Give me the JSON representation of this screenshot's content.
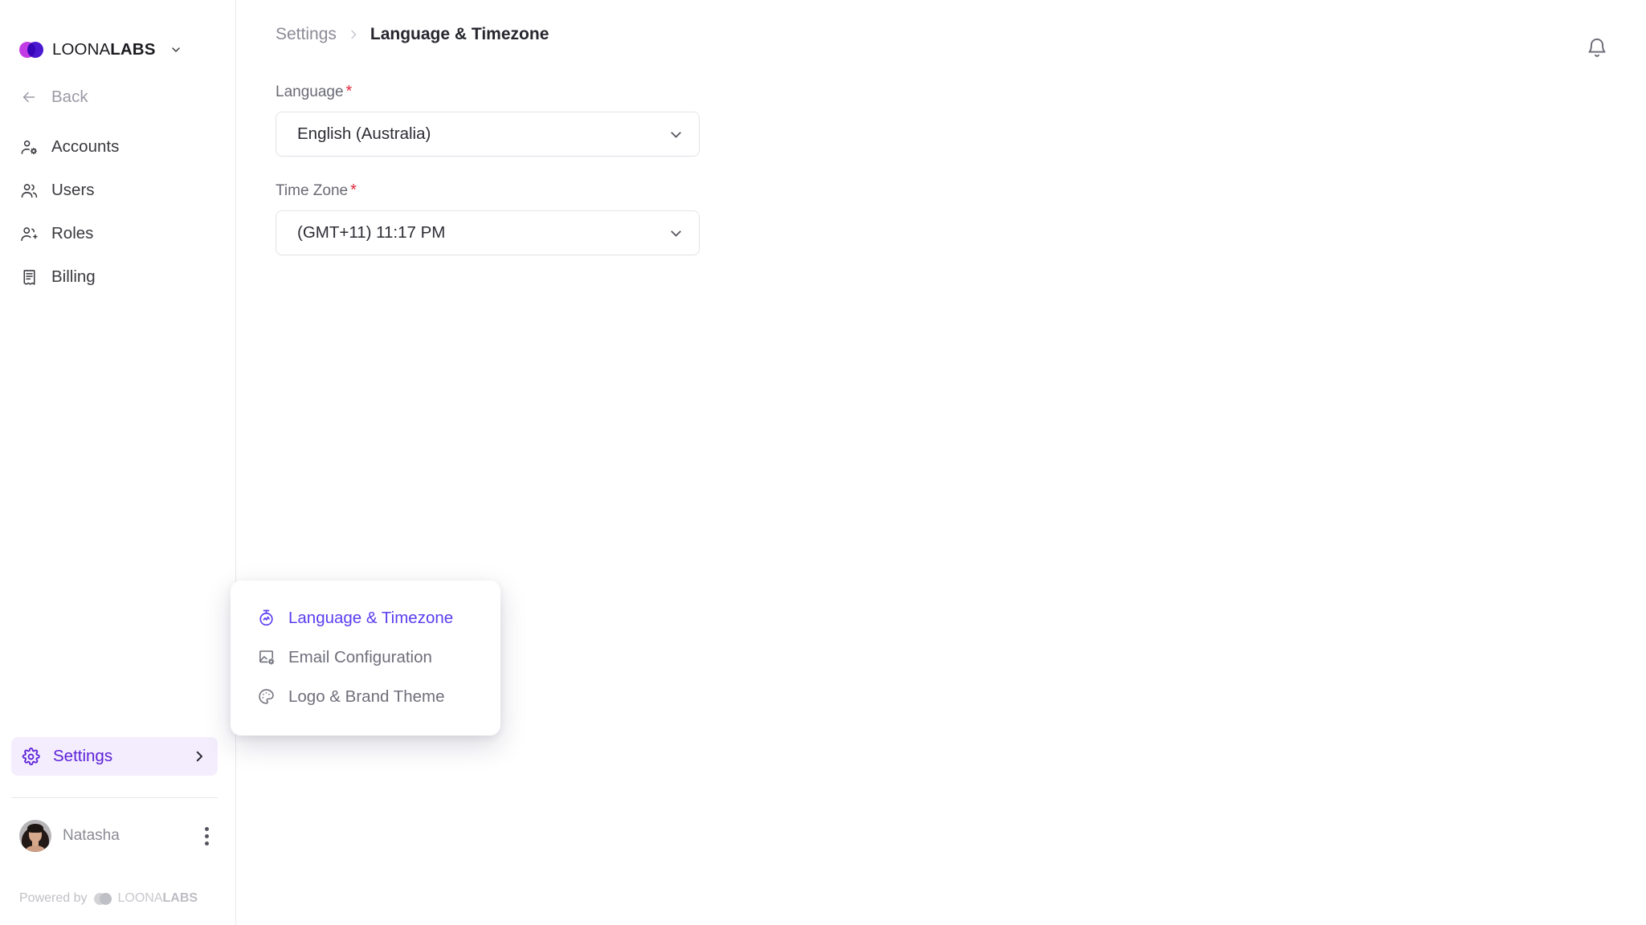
{
  "brand": {
    "name_regular": "LOONA",
    "name_bold": "LABS",
    "caret_icon": "chevron-down-icon",
    "logo_icon": "loonalabs-logo-icon",
    "colors": {
      "logo_pink": "#c13ce4",
      "logo_purple": "#4a18cf",
      "accent": "#5b20d8",
      "menu_accent": "#5b3df0"
    }
  },
  "sidebar": {
    "back": {
      "label": "Back",
      "icon": "arrow-left-icon"
    },
    "items": [
      {
        "label": "Accounts",
        "icon": "user-gear-icon"
      },
      {
        "label": "Users",
        "icon": "users-icon"
      },
      {
        "label": "Roles",
        "icon": "user-plus-icon"
      },
      {
        "label": "Billing",
        "icon": "receipt-icon"
      }
    ],
    "settings": {
      "label": "Settings",
      "icon": "gear-icon",
      "chevron": "chevron-right-icon"
    },
    "user": {
      "name": "Natasha",
      "avatar": "user-avatar",
      "menu_icon": "three-dots-vertical-icon"
    },
    "footer": {
      "prefix": "Powered by",
      "name_regular": "LOONA",
      "name_bold": "LABS",
      "logo_icon": "loonalabs-logo-icon"
    }
  },
  "header": {
    "breadcrumb": {
      "parent": "Settings",
      "separator_icon": "chevron-right-icon",
      "current": "Language & Timezone"
    },
    "notifications_icon": "bell-icon"
  },
  "main": {
    "fields": [
      {
        "label": "Language",
        "required_marker": "*",
        "value": "English (Australia)",
        "chevron_icon": "chevron-down-icon"
      },
      {
        "label": "Time Zone",
        "required_marker": "*",
        "value": "(GMT+11) 11:17 PM",
        "chevron_icon": "chevron-down-icon"
      }
    ]
  },
  "popup": {
    "items": [
      {
        "label": "Language & Timezone",
        "icon": "stopwatch-icon",
        "active": true
      },
      {
        "label": "Email Configuration",
        "icon": "image-gear-icon",
        "active": false
      },
      {
        "label": "Logo & Brand Theme",
        "icon": "palette-icon",
        "active": false
      }
    ]
  }
}
